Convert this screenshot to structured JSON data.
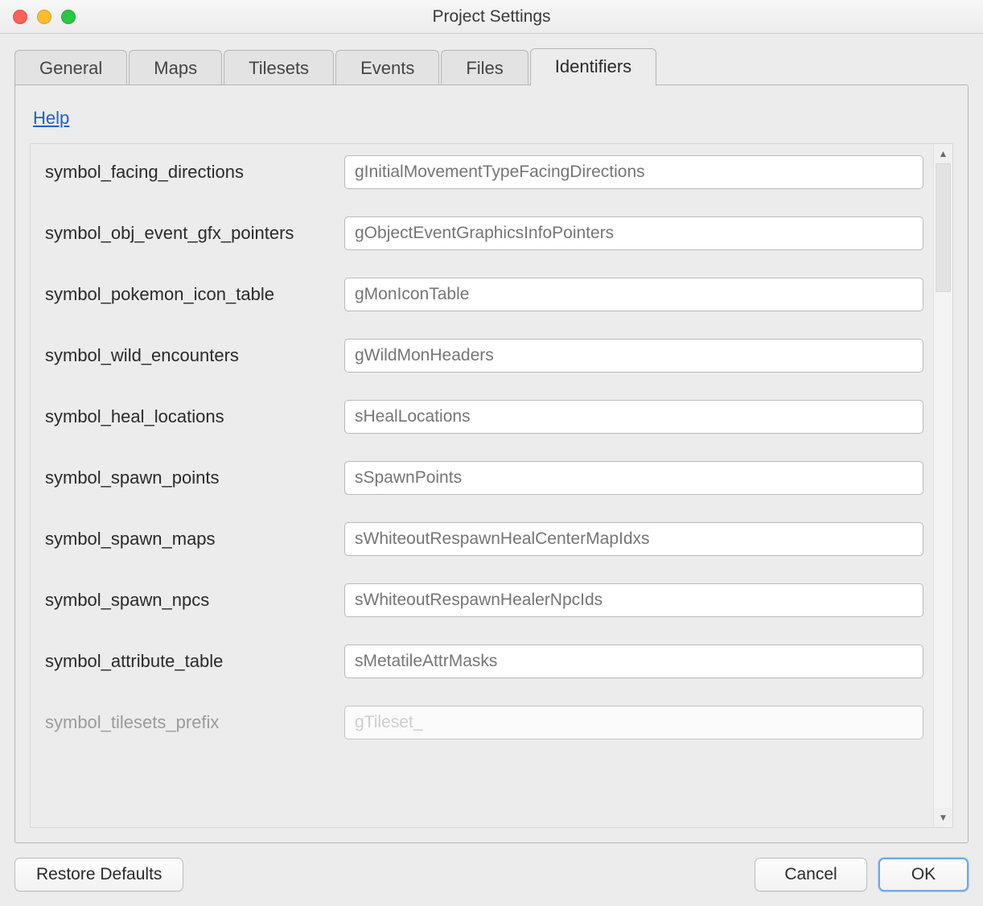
{
  "window": {
    "title": "Project Settings"
  },
  "tabs": [
    {
      "label": "General",
      "active": false
    },
    {
      "label": "Maps",
      "active": false
    },
    {
      "label": "Tilesets",
      "active": false
    },
    {
      "label": "Events",
      "active": false
    },
    {
      "label": "Files",
      "active": false
    },
    {
      "label": "Identifiers",
      "active": true
    }
  ],
  "help": {
    "label": "Help"
  },
  "identifiers": [
    {
      "label": "symbol_facing_directions",
      "placeholder": "gInitialMovementTypeFacingDirections"
    },
    {
      "label": "symbol_obj_event_gfx_pointers",
      "placeholder": "gObjectEventGraphicsInfoPointers"
    },
    {
      "label": "symbol_pokemon_icon_table",
      "placeholder": "gMonIconTable"
    },
    {
      "label": "symbol_wild_encounters",
      "placeholder": "gWildMonHeaders"
    },
    {
      "label": "symbol_heal_locations",
      "placeholder": "sHealLocations"
    },
    {
      "label": "symbol_spawn_points",
      "placeholder": "sSpawnPoints"
    },
    {
      "label": "symbol_spawn_maps",
      "placeholder": "sWhiteoutRespawnHealCenterMapIdxs"
    },
    {
      "label": "symbol_spawn_npcs",
      "placeholder": "sWhiteoutRespawnHealerNpcIds"
    },
    {
      "label": "symbol_attribute_table",
      "placeholder": "sMetatileAttrMasks"
    },
    {
      "label": "symbol_tilesets_prefix",
      "placeholder": "gTileset_"
    }
  ],
  "footer": {
    "restore": "Restore Defaults",
    "cancel": "Cancel",
    "ok": "OK"
  }
}
